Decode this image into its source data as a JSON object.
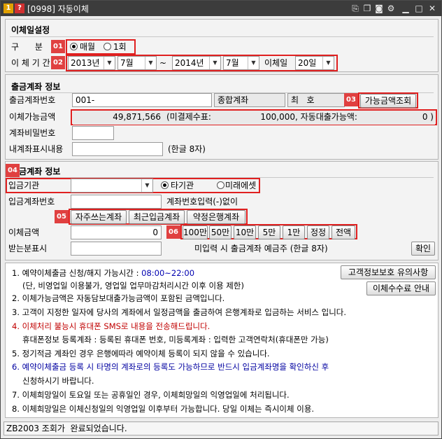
{
  "window": {
    "title": "[0998] 자동이체",
    "icon1": "1",
    "icon2": "?"
  },
  "section_transfer": {
    "title": "이체일설정",
    "type_label": "구      분",
    "radio_monthly": "매월",
    "radio_once": "1회",
    "period_label": "이 체 기 간",
    "start_year": "2013년",
    "start_month": "7월",
    "tilde": "~",
    "end_year": "2014년",
    "end_month": "7월",
    "day_label": "이체일",
    "day_value": "20일"
  },
  "section_withdraw": {
    "title": "출금계좌 정보",
    "account_label": "출금계좌번호",
    "account_value": "001-",
    "account_type": "종합계좌",
    "name_label": "최   호",
    "check_button": "가능금액조회",
    "amount_label": "이체가능금액",
    "amount_value": "49,871,566",
    "unsettled_label": "(미결제수표:",
    "unsettled_value": "100,000",
    "auto_loan_label": ", 자동대출가능액:",
    "auto_loan_value": "0 )",
    "password_label": "계좌비밀번호",
    "memo_label": "내계좌표시내용",
    "memo_hint": "(한글 8자)"
  },
  "section_deposit": {
    "title": "입금계좌 정보",
    "bank_label": "입금기관",
    "radio_other": "타기관",
    "radio_mirae": "미래에셋",
    "account_label": "입금계좌번호",
    "account_hint": "계좌번호입력(-)없이",
    "btn_favorite": "자주쓰는계좌",
    "btn_recent": "최근입금계좌",
    "btn_agreed": "약정은행계좌",
    "amount_label": "이체금액",
    "amount_value": "0",
    "quick_amounts": [
      "100만",
      "50만",
      "10만",
      "5만",
      "1만",
      "정정",
      "전액"
    ],
    "receiver_label": "받는분표시",
    "receiver_hint": "미입력 시 출금계좌 예금주 (한글 8자)",
    "confirm_button": "확인"
  },
  "badges": [
    "01",
    "02",
    "03",
    "04",
    "05",
    "06"
  ],
  "notes": {
    "privacy_button": "고객정보보호 유의사항",
    "fee_button": "이체수수료 안내",
    "line1_prefix": "1. 예약이체출금 신청/해지 가능시간 : ",
    "line1_time": "08:00~22:00",
    "line1b": "(단, 비영업일 이용불가, 영업일 업무마감처리시간 이후 이용 제한)",
    "line2": "2. 이체가능금액은 자동담보대출가능금액이 포함된 금액입니다.",
    "line3": "3. 고객이 지정한 일자에 당사의 계좌에서 일정금액을 출금하여 은행계좌로 입금하는 서비스 입니다.",
    "line4": "4. 이체처리 불능시 휴대폰 SMS로 내용을 전송해드립니다.",
    "line4b": "휴대폰정보 등록계좌 : 등록된 휴대폰 번호, 미등록계좌 : 입력한 고객연락처(휴대폰만 가능)",
    "line5": "5. 정기적금 계좌인 경우 은행에따라 예약이체 등록이 되지 않을 수 있습니다.",
    "line6": "6. 예약이체출금 등록 시 타명의 계좌로의 등록도 가능하므로 반드시 입금계좌명을 확인하신 후",
    "line6b": "신청하시기 바랍니다.",
    "line7": "7. 이체희망일이 토요일 또는 공휴일인 경우, 이체희망일의 익영업일에 처리됩니다.",
    "line8": "8. 이체희망일은 이체신청일의 익영업일 이후부터 가능합니다. 당일 이체는 즉시이체 이용."
  },
  "status": {
    "text": "ZB2003 조회가  완료되었습니다."
  },
  "colors": {
    "titlebar": "#3c3c3c",
    "highlight_border": "#e02020",
    "badge": "#e04040",
    "note_red": "#c00000",
    "note_blue": "#0000a0"
  }
}
